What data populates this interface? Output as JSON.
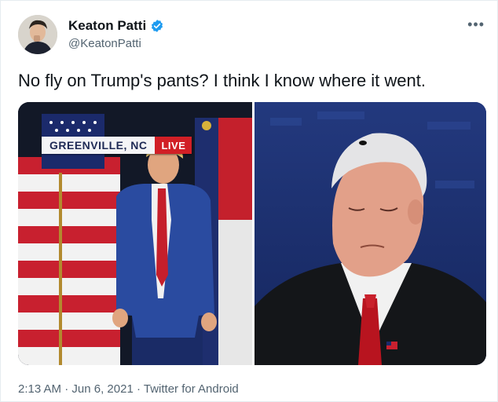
{
  "tweet": {
    "display_name": "Keaton Patti",
    "handle": "@KeatonPatti",
    "text": "No fly on Trump's pants? I think I know where it went.",
    "more_icon": "more-dots-icon",
    "verified_icon": "verified-badge-icon",
    "colors": {
      "text": "#0f1419",
      "secondary": "#536471",
      "verified": "#1d9bf0",
      "live_red": "#d11f26"
    }
  },
  "media": {
    "left_chyron": {
      "place": "GREENVILLE, NC",
      "live": "LIVE"
    }
  },
  "meta": {
    "time": "2:13 AM",
    "sep1": " · ",
    "date": "Jun 6, 2021",
    "sep2": " · ",
    "source": "Twitter for Android"
  }
}
